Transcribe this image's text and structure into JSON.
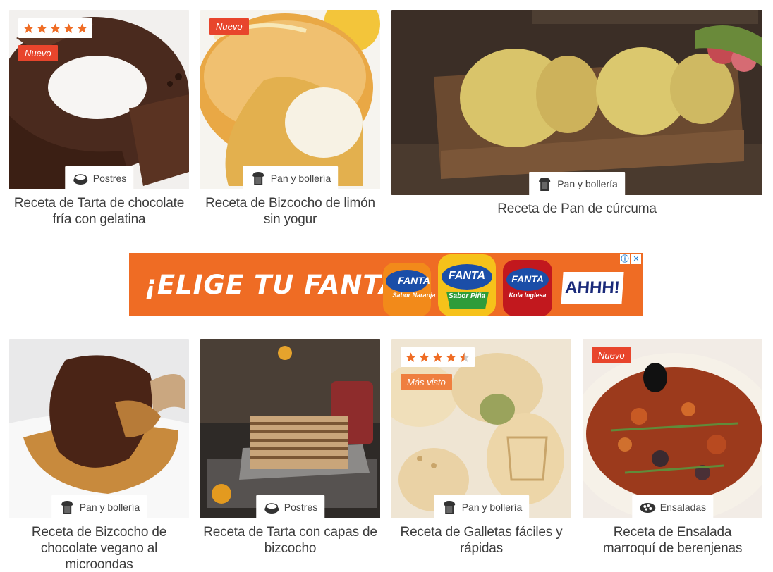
{
  "cards": [
    {
      "title": "Receta de Tarta de chocolate fría con gelatina",
      "category": "Postres",
      "category_icon": "cup-icon",
      "badge": "Nuevo",
      "stars": 5
    },
    {
      "title": "Receta de Bizcocho de limón sin yogur",
      "category": "Pan y bollería",
      "category_icon": "bread-icon",
      "badge": "Nuevo"
    },
    {
      "title": "Receta de Pan de cúrcuma",
      "category": "Pan y bollería",
      "category_icon": "bread-icon"
    },
    {
      "title": "Receta de Bizcocho de chocolate vegano al microondas",
      "category": "Pan y bollería",
      "category_icon": "bread-icon"
    },
    {
      "title": "Receta de Tarta con capas de bizcocho",
      "category": "Postres",
      "category_icon": "cup-icon"
    },
    {
      "title": "Receta de Galletas fáciles y rápidas",
      "category": "Pan y bollería",
      "category_icon": "bread-icon",
      "badge": "Más visto",
      "stars": 4.5
    },
    {
      "title": "Receta de Ensalada marroquí de berenjenas",
      "category": "Ensaladas",
      "category_icon": "salad-icon",
      "badge": "Nuevo"
    }
  ],
  "ad": {
    "slogan": "¡ELIGE TU FANTA!",
    "bottles": [
      {
        "brand": "FANTA",
        "flavor": "Sabor Naranja"
      },
      {
        "brand": "FANTA",
        "flavor": "Sabor Piña"
      },
      {
        "brand": "FANTA",
        "flavor": "Kola Inglesa"
      }
    ],
    "shout": "AHHH!",
    "info_icon": "ⓘ",
    "close_icon": "✕"
  },
  "colors": {
    "badge_new": "#e8452c",
    "badge_most_viewed": "#ef7f3f",
    "star": "#ef6c24",
    "ad_bg": "#ef6c24"
  }
}
